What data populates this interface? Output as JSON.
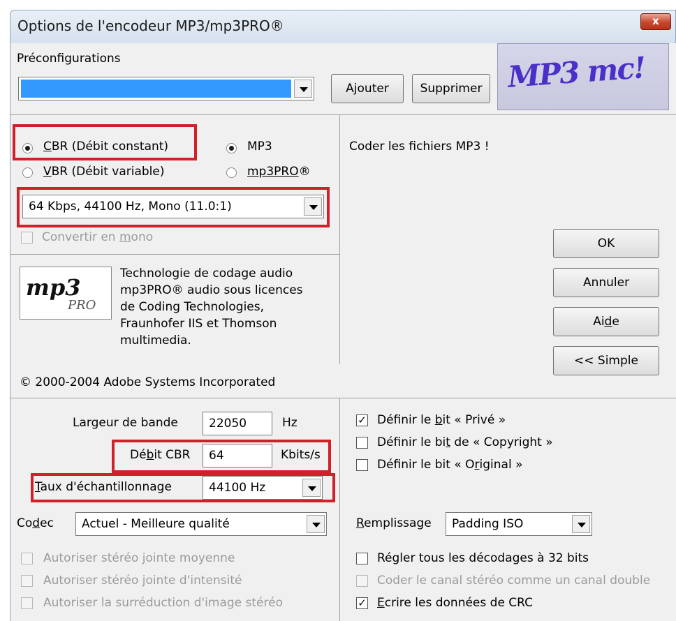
{
  "window": {
    "title": "Options de l'encodeur MP3/mp3PRO®",
    "close_label": "x"
  },
  "presets": {
    "label": "Préconfigurations",
    "selected": "",
    "add_label": "Ajouter",
    "delete_label": "Supprimer",
    "logo_text": "MP3 mc!"
  },
  "mode": {
    "cbr_label": "CBR (Débit constant)",
    "vbr_label": "VBR (Débit variable)",
    "mp3_label": "MP3",
    "mp3pro_label": "mp3PRO®",
    "bitrate_selected": "64 Kbps, 44100 Hz, Mono (11.0:1)",
    "mono_label": "Convertir en mono"
  },
  "description": "Coder les fichiers MP3 !",
  "actions": {
    "ok": "OK",
    "cancel": "Annuler",
    "help": "Aide",
    "simple": "<< Simple"
  },
  "licence": {
    "logo_text": "mp3",
    "logo_sub": "PRO",
    "lines": [
      "Technologie de codage audio",
      "mp3PRO® audio sous licences",
      "de Coding Technologies,",
      "Fraunhofer IIS et Thomson",
      "multimedia."
    ],
    "copyright": "© 2000-2004 Adobe Systems Incorporated"
  },
  "advanced": {
    "bandwidth_label": "Largeur de bande",
    "bandwidth_value": "22050",
    "bandwidth_unit": "Hz",
    "cbr_rate_label": "Débit CBR",
    "cbr_rate_value": "64",
    "cbr_rate_unit": "Kbits/s",
    "sample_rate_label": "Taux d'échantillonnage",
    "sample_rate_value": "44100 Hz",
    "codec_label": "Codec",
    "codec_value": "Actuel - Meilleure qualité",
    "stereo_options": [
      "Autoriser stéréo jointe moyenne",
      "Autoriser stéréo jointe d'intensité",
      "Autoriser la surréduction d'image stéréo"
    ]
  },
  "bits": {
    "private_label": "Définir le bit « Privé »",
    "copyright_label": "Définir le bit de « Copyright »",
    "original_label": "Définir le bit « Original »",
    "padding_label": "Remplissage",
    "padding_value": "Padding ISO",
    "decode32_label": "Régler tous les décodages à 32 bits",
    "stereo_mono_label": "Coder le canal stéréo comme un canal double",
    "crc_label": "Ecrire les données de CRC"
  },
  "colors": {
    "highlight": "#d0202a",
    "selection": "#3399ff"
  }
}
